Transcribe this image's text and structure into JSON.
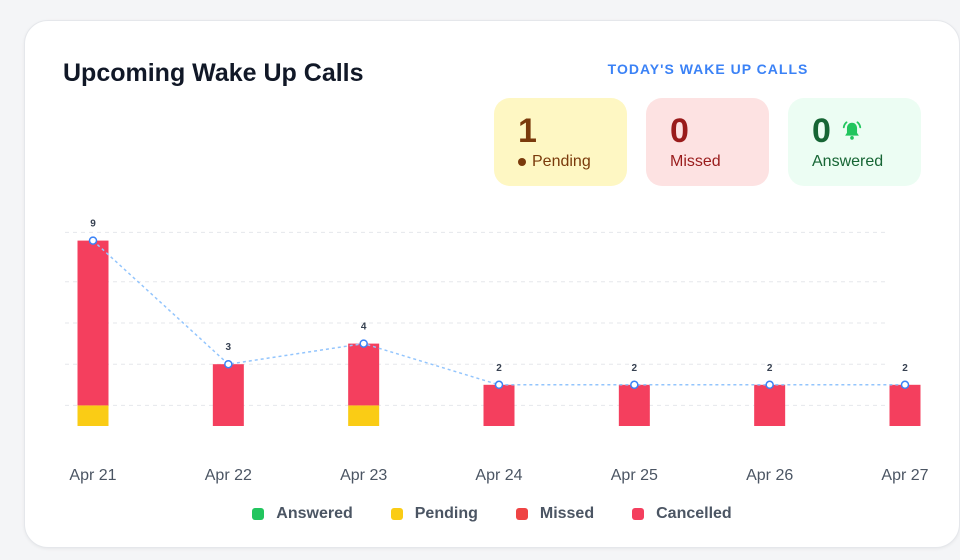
{
  "card": {
    "title": "Upcoming Wake Up Calls"
  },
  "today": {
    "title": "TODAY'S WAKE UP CALLS",
    "pending": {
      "value": "1",
      "label": "Pending"
    },
    "missed": {
      "value": "0",
      "label": "Missed"
    },
    "answered": {
      "value": "0",
      "label": "Answered"
    }
  },
  "colors": {
    "answered": "#22c55e",
    "pending": "#facc15",
    "missed": "#ef4444",
    "cancelled": "#f43f5e",
    "trend_line": "#93c5fd",
    "accent": "#3b82f6"
  },
  "chart_data": {
    "type": "bar",
    "stacked": true,
    "categories": [
      "Apr 21",
      "Apr 22",
      "Apr 23",
      "Apr 24",
      "Apr 25",
      "Apr 26",
      "Apr 27"
    ],
    "series": [
      {
        "name": "Answered",
        "values": [
          0,
          0,
          0,
          0,
          0,
          0,
          0
        ]
      },
      {
        "name": "Pending",
        "values": [
          1,
          0,
          1,
          0,
          0,
          0,
          0
        ]
      },
      {
        "name": "Missed",
        "values": [
          0,
          0,
          0,
          0,
          0,
          0,
          0
        ]
      },
      {
        "name": "Cancelled",
        "values": [
          8,
          3,
          3,
          2,
          2,
          2,
          2
        ]
      }
    ],
    "totals": [
      9,
      3,
      4,
      2,
      2,
      2,
      2
    ],
    "ylim": [
      0,
      10
    ],
    "grid": true,
    "legend_position": "bottom"
  },
  "legend": [
    {
      "label": "Answered",
      "color": "#22c55e"
    },
    {
      "label": "Pending",
      "color": "#facc15"
    },
    {
      "label": "Missed",
      "color": "#ef4444"
    },
    {
      "label": "Cancelled",
      "color": "#f43f5e"
    }
  ]
}
